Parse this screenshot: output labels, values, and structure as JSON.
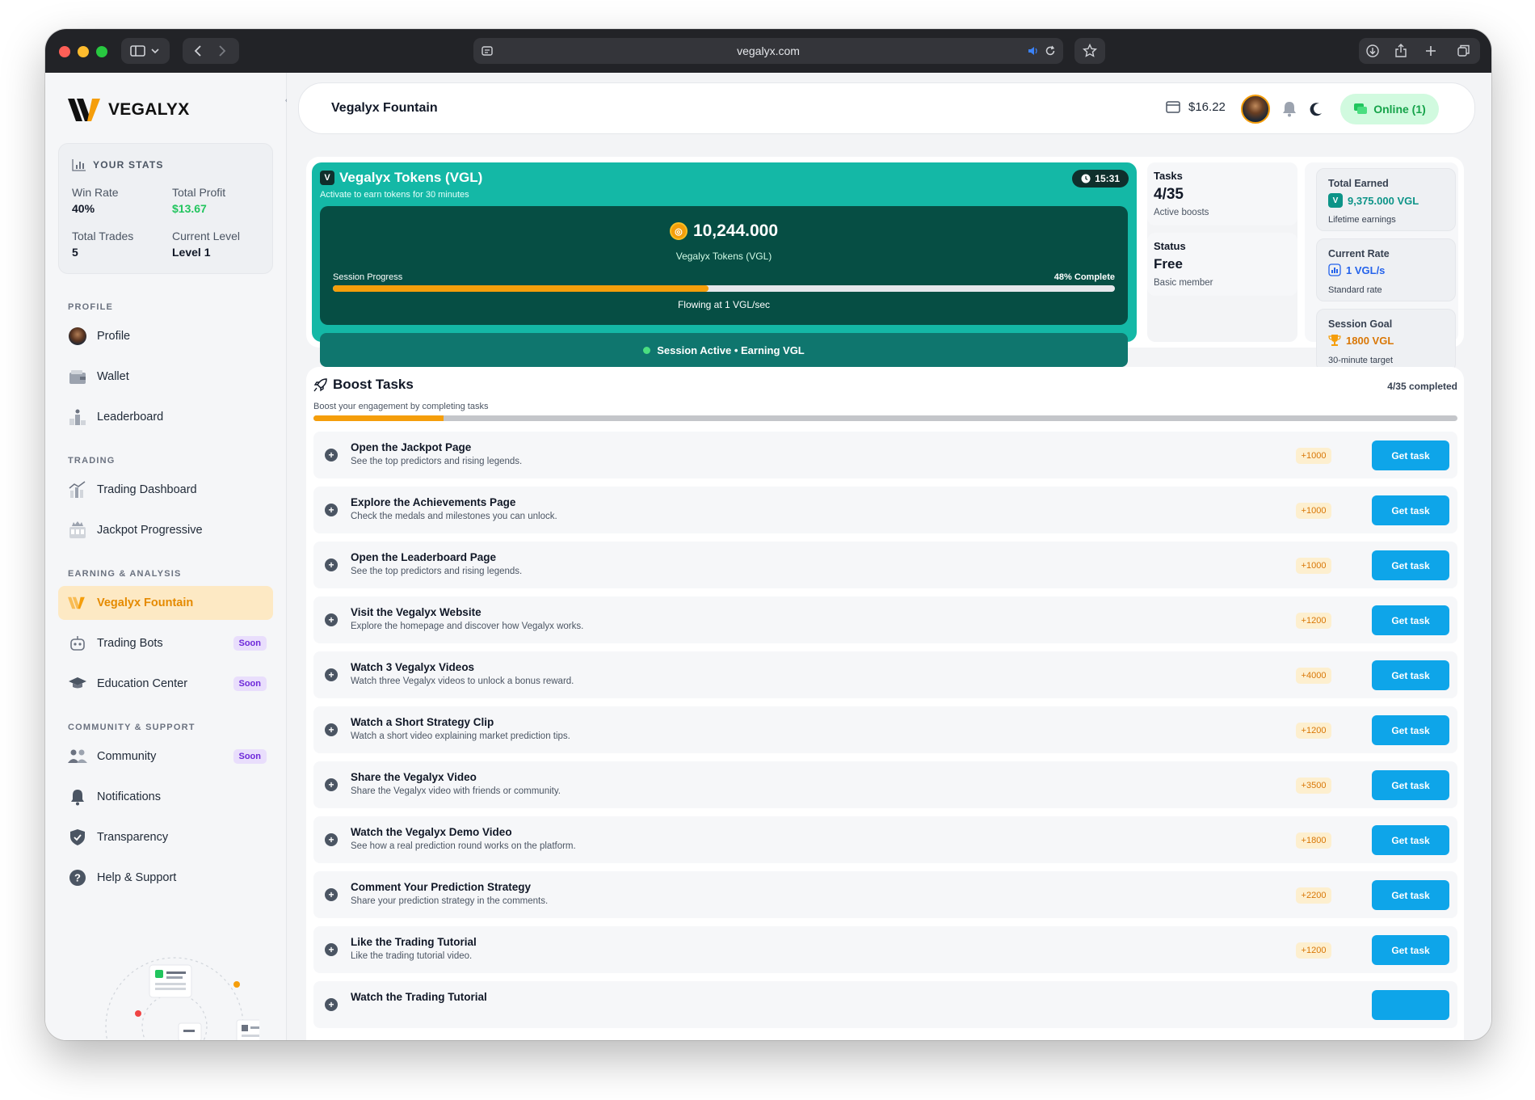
{
  "browser": {
    "url": "vegalyx.com"
  },
  "brand": {
    "name": "VEGALYX",
    "accent": "#f59e0b",
    "teal": "#14b8a6",
    "button": "#0ea5e9"
  },
  "stats": {
    "heading": "YOUR STATS",
    "win_rate_label": "Win Rate",
    "win_rate": "40%",
    "total_profit_label": "Total Profit",
    "total_profit": "$13.67",
    "total_trades_label": "Total Trades",
    "total_trades": "5",
    "level_label": "Current Level",
    "level": "Level 1"
  },
  "nav": {
    "profile_h": "PROFILE",
    "profile": "Profile",
    "wallet": "Wallet",
    "leaderboard": "Leaderboard",
    "trading_h": "TRADING",
    "trading_dashboard": "Trading Dashboard",
    "jackpot": "Jackpot Progressive",
    "earning_h": "EARNING & ANALYSIS",
    "fountain": "Vegalyx Fountain",
    "bots": "Trading Bots",
    "education": "Education Center",
    "community_h": "COMMUNITY & SUPPORT",
    "community": "Community",
    "notifications": "Notifications",
    "transparency": "Transparency",
    "help": "Help & Support",
    "soon": "Soon"
  },
  "header": {
    "title": "Vegalyx Fountain",
    "balance": "$16.22",
    "online": "Online (1)"
  },
  "fountain": {
    "title": "Vegalyx Tokens (VGL)",
    "subtitle": "Activate to earn tokens for 30 minutes",
    "timer": "15:31",
    "amount": "10,244.000",
    "amount_label": "Vegalyx Tokens (VGL)",
    "progress_label": "Session Progress",
    "progress_pct_text": "48% Complete",
    "progress_value": 0.48,
    "flowing": "Flowing at  1 VGL/sec",
    "session": "Session Active • Earning VGL"
  },
  "summary": {
    "tasks_label": "Tasks",
    "tasks_value": "4/35",
    "tasks_sub": "Active boosts",
    "status_label": "Status",
    "status_value": "Free",
    "status_sub": "Basic member",
    "earned_label": "Total Earned",
    "earned_value": "9,375.000 VGL",
    "earned_sub": "Lifetime earnings",
    "rate_label": "Current Rate",
    "rate_value": "1 VGL/s",
    "rate_sub": "Standard rate",
    "goal_label": "Session Goal",
    "goal_value": "1800 VGL",
    "goal_sub": "30-minute target"
  },
  "boost": {
    "title": "Boost Tasks",
    "subtitle": "Boost your engagement by completing tasks",
    "count": "4/35 completed",
    "progress_value": 0.114,
    "button": "Get task",
    "tasks": [
      {
        "title": "Open the Jackpot Page",
        "desc": "See the top predictors and rising legends.",
        "points": "+1000"
      },
      {
        "title": "Explore the Achievements Page",
        "desc": "Check the medals and milestones you can unlock.",
        "points": "+1000"
      },
      {
        "title": "Open the Leaderboard Page",
        "desc": "See the top predictors and rising legends.",
        "points": "+1000"
      },
      {
        "title": "Visit the Vegalyx Website",
        "desc": "Explore the homepage and discover how Vegalyx works.",
        "points": "+1200"
      },
      {
        "title": "Watch 3 Vegalyx Videos",
        "desc": "Watch three Vegalyx videos to unlock a bonus reward.",
        "points": "+4000"
      },
      {
        "title": "Watch a Short Strategy Clip",
        "desc": "Watch a short video explaining market prediction tips.",
        "points": "+1200"
      },
      {
        "title": "Share the Vegalyx Video",
        "desc": "Share the Vegalyx video with friends or community.",
        "points": "+3500"
      },
      {
        "title": "Watch the Vegalyx Demo Video",
        "desc": "See how a real prediction round works on the platform.",
        "points": "+1800"
      },
      {
        "title": "Comment Your Prediction Strategy",
        "desc": "Share your prediction strategy in the comments.",
        "points": "+2200"
      },
      {
        "title": "Like the Trading Tutorial",
        "desc": "Like the trading tutorial video.",
        "points": "+1200"
      },
      {
        "title": "Watch the Trading Tutorial",
        "desc": "",
        "points": ""
      }
    ]
  }
}
